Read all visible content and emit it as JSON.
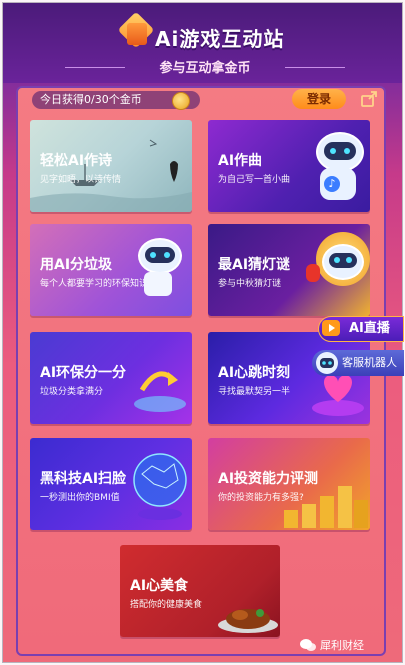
{
  "header": {
    "title": "Ai游戏互动站",
    "subtitle": "参与互动拿金币"
  },
  "status": {
    "today_coins": "今日获得0/30个金币",
    "login_label": "登录"
  },
  "cards": [
    {
      "title": "轻松AI作诗",
      "subtitle": "见字如晤，以诗传情"
    },
    {
      "title": "AI作曲",
      "subtitle": "为自己写一首小曲"
    },
    {
      "title": "用AI分垃圾",
      "subtitle": "每个人都要学习的环保知识"
    },
    {
      "title": "最AI猜灯谜",
      "subtitle": "参与中秋猜灯谜"
    },
    {
      "title": "AI环保分一分",
      "subtitle": "垃圾分类拿满分"
    },
    {
      "title": "AI心跳时刻",
      "subtitle": "寻找最默契另一半"
    },
    {
      "title": "黑科技AI扫脸",
      "subtitle": "一秒测出你的BMI值"
    },
    {
      "title": "AI投资能力评测",
      "subtitle": "你的投资能力有多强?"
    },
    {
      "title": "AI心美食",
      "subtitle": "搭配你的健康美食"
    }
  ],
  "side": {
    "live_label": "AI直播",
    "service_label": "客服机器人"
  },
  "watermark": "犀利财经",
  "colors": {
    "header_bg": "#5a1f86",
    "panel_bg": "#f06a7a",
    "login_bg": "#ff8c1a",
    "accent_orange": "#ff9a1a"
  }
}
